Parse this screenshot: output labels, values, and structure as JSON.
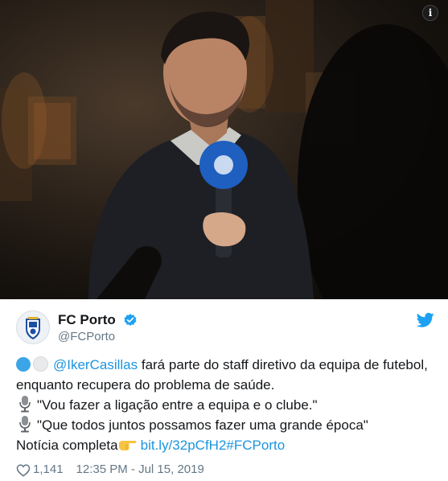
{
  "photo": {
    "description_icon": "info-icon",
    "info_label": "i"
  },
  "author": {
    "name": "FC Porto",
    "handle": "@FCPorto",
    "verified": true,
    "avatar_icon": "fc-porto-crest"
  },
  "tweet": {
    "mention": "@IkerCasillas",
    "line1_rest": " fará parte do staff diretivo da equipa de futebol, enquanto recupera do problema de saúde.",
    "quote1": "\"Vou fazer a ligação entre a equipa e o clube.\"",
    "quote2": "\"Que todos juntos possamos fazer uma grande época\"",
    "news_label": "Notícia completa",
    "link": "bit.ly/32pCfH2",
    "hashtag": "#FCPorto"
  },
  "footer": {
    "likes": "1,141",
    "timestamp": "12:35 PM - Jul 15, 2019"
  },
  "colors": {
    "link": "#1b95e0",
    "verified": "#1da1f2",
    "twitter_bird": "#1da1f2",
    "muted": "#657786"
  }
}
